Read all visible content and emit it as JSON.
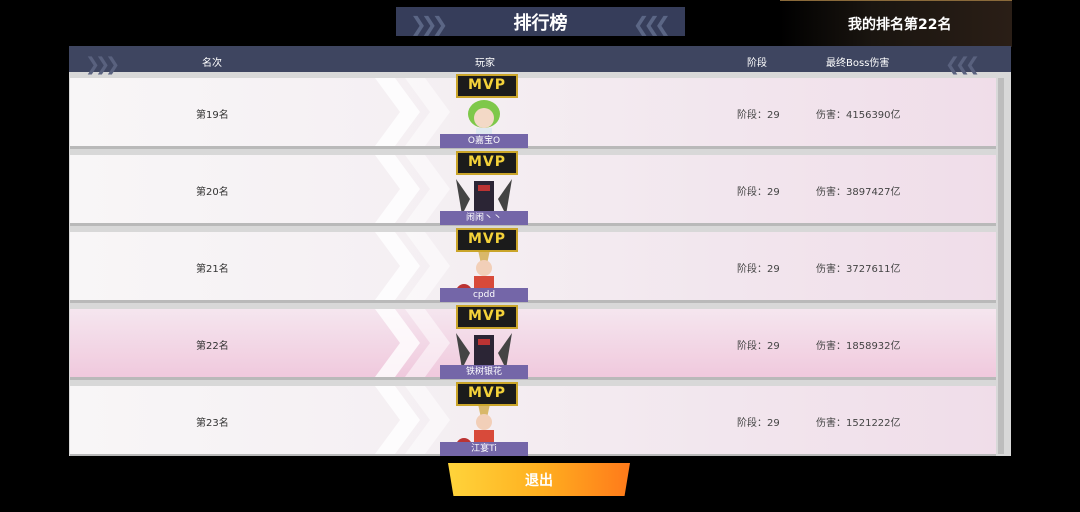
{
  "title": "排行榜",
  "my_rank": "我的排名第22名",
  "headers": {
    "rank": "名次",
    "player": "玩家",
    "stage": "阶段",
    "damage": "最终Boss伤害"
  },
  "rows": [
    {
      "rank": "第19名",
      "badge": "MVP",
      "name": "O嘉宝O",
      "stage": "阶段：29",
      "damage": "伤害：4156390亿",
      "mine": false,
      "avatar": "green-hair-character-icon"
    },
    {
      "rank": "第20名",
      "badge": "MVP",
      "name": "闹闹丶丶",
      "stage": "阶段：29",
      "damage": "伤害：3897427亿",
      "mine": false,
      "avatar": "dark-armored-knight-icon"
    },
    {
      "rank": "第21名",
      "badge": "MVP",
      "name": "cpdd",
      "stage": "阶段：29",
      "damage": "伤害：3727611亿",
      "mine": false,
      "avatar": "red-bunny-warrior-icon"
    },
    {
      "rank": "第22名",
      "badge": "MVP",
      "name": "铁树银花",
      "stage": "阶段：29",
      "damage": "伤害：1858932亿",
      "mine": true,
      "avatar": "dark-armored-knight-icon"
    },
    {
      "rank": "第23名",
      "badge": "MVP",
      "name": "江宴Ti",
      "stage": "阶段：29",
      "damage": "伤害：1521222亿",
      "mine": false,
      "avatar": "red-bunny-warrior-icon"
    }
  ],
  "exit_label": "退出",
  "colors": {
    "header_bg": "#3e4560",
    "name_bar": "#7466a8",
    "mvp_text": "#f4d23a",
    "exit_from": "#ffd43b",
    "exit_to": "#ff7a1a"
  }
}
